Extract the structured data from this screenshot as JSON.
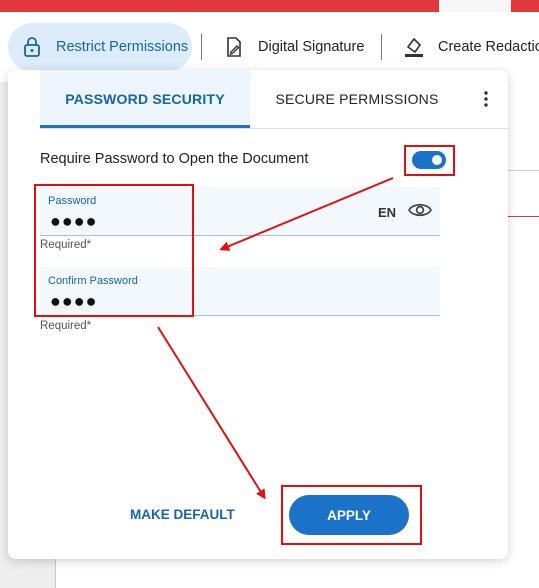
{
  "toolbar": {
    "restrict_permissions_label": "Restrict Permissions",
    "digital_signature_label": "Digital Signature",
    "create_redaction_label": "Create Redaction"
  },
  "tabs": {
    "password_security": "PASSWORD SECURITY",
    "secure_permissions": "SECURE PERMISSIONS"
  },
  "form": {
    "require_password_label": "Require Password to Open the Document",
    "require_password_enabled": true,
    "password_label": "Password",
    "password_value": "●●●●",
    "confirm_label": "Confirm Password",
    "confirm_value": "●●●●",
    "language": "EN",
    "required_text": "Required*"
  },
  "actions": {
    "make_default_label": "MAKE DEFAULT",
    "apply_label": "APPLY"
  },
  "colors": {
    "accent": "#1a73c9",
    "annotation": "#e01010",
    "topbar": "#e0383c"
  }
}
